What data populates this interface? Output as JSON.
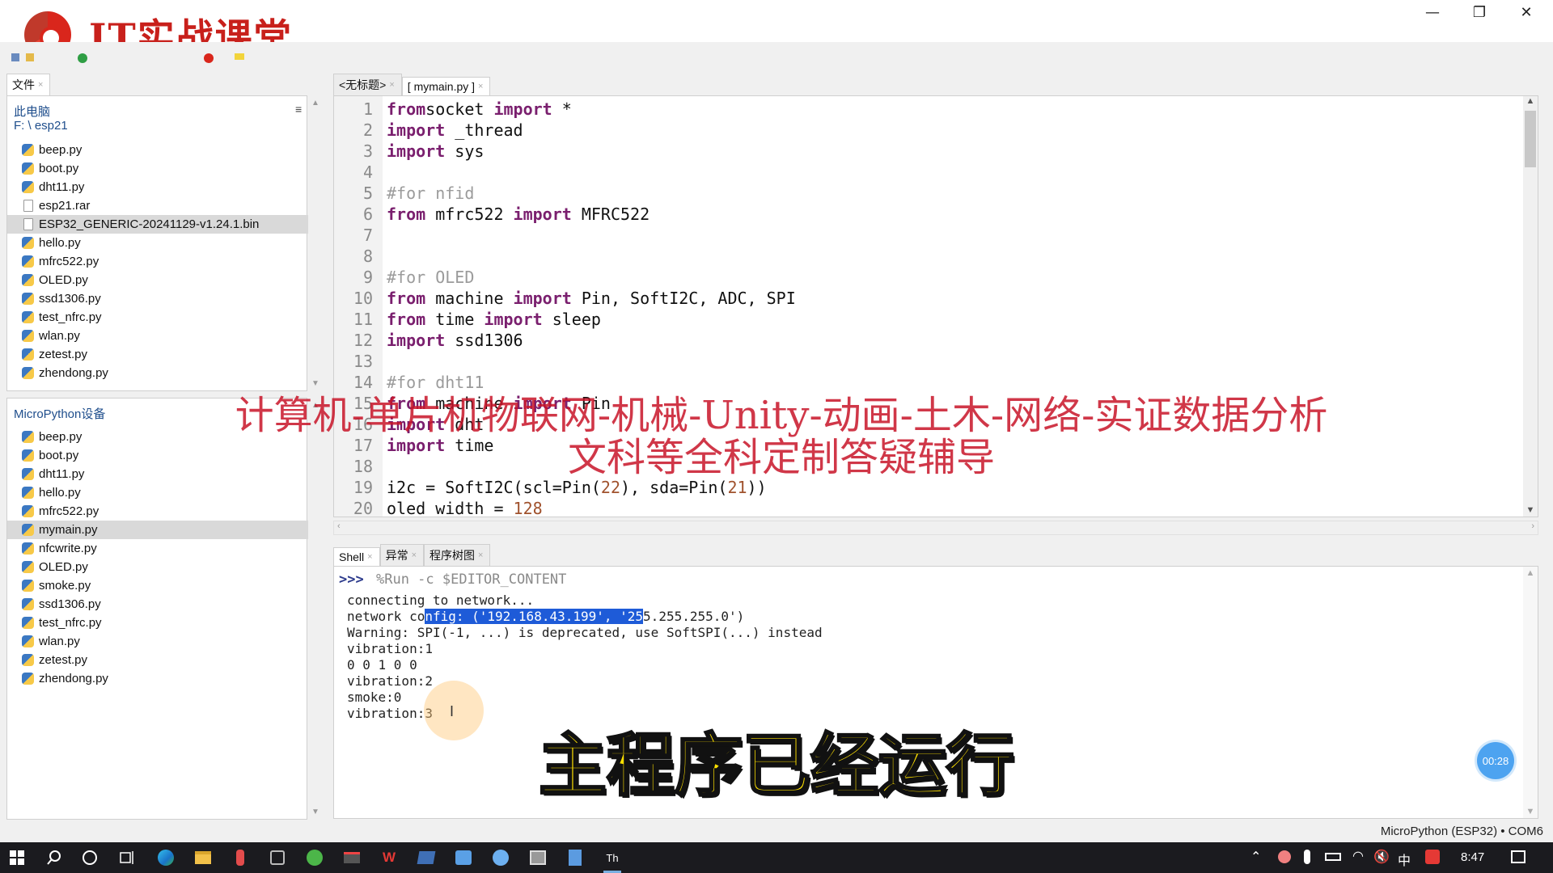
{
  "logo": {
    "text": "IT实战课堂"
  },
  "window": {
    "minimize": "—",
    "maximize": "❐",
    "close": "✕"
  },
  "files_panel": {
    "tab_label": "文件",
    "computer_label": "此电脑",
    "path": "F: \\ esp21",
    "items": [
      {
        "name": "beep.py",
        "type": "py"
      },
      {
        "name": "boot.py",
        "type": "py"
      },
      {
        "name": "dht11.py",
        "type": "py"
      },
      {
        "name": "esp21.rar",
        "type": "file"
      },
      {
        "name": "ESP32_GENERIC-20241129-v1.24.1.bin",
        "type": "file",
        "selected": true
      },
      {
        "name": "hello.py",
        "type": "py"
      },
      {
        "name": "mfrc522.py",
        "type": "py"
      },
      {
        "name": "OLED.py",
        "type": "py"
      },
      {
        "name": "ssd1306.py",
        "type": "py"
      },
      {
        "name": "test_nfrc.py",
        "type": "py"
      },
      {
        "name": "wlan.py",
        "type": "py"
      },
      {
        "name": "zetest.py",
        "type": "py"
      },
      {
        "name": "zhendong.py",
        "type": "py"
      }
    ]
  },
  "device_panel": {
    "title": "MicroPython设备",
    "items": [
      {
        "name": "beep.py"
      },
      {
        "name": "boot.py"
      },
      {
        "name": "dht11.py"
      },
      {
        "name": "hello.py"
      },
      {
        "name": "mfrc522.py"
      },
      {
        "name": "mymain.py",
        "selected": true
      },
      {
        "name": "nfcwrite.py"
      },
      {
        "name": "OLED.py"
      },
      {
        "name": "smoke.py"
      },
      {
        "name": "ssd1306.py"
      },
      {
        "name": "test_nfrc.py"
      },
      {
        "name": "wlan.py"
      },
      {
        "name": "zetest.py"
      },
      {
        "name": "zhendong.py"
      }
    ]
  },
  "editor": {
    "tabs": [
      "<无标题>",
      "[ mymain.py ]"
    ],
    "lines": [
      [
        [
          "kw",
          "from"
        ],
        [
          "",
          "socket "
        ],
        [
          "kw",
          "import"
        ],
        [
          "",
          " *"
        ]
      ],
      [
        [
          "kw",
          "import"
        ],
        [
          "",
          " _thread"
        ]
      ],
      [
        [
          "kw",
          "import"
        ],
        [
          "",
          " sys"
        ]
      ],
      [],
      [
        [
          "cm",
          "#for nfid"
        ]
      ],
      [
        [
          "kw",
          "from"
        ],
        [
          "",
          " mfrc522 "
        ],
        [
          "kw",
          "import"
        ],
        [
          "",
          " MFRC522"
        ]
      ],
      [],
      [],
      [
        [
          "cm",
          "#for OLED"
        ]
      ],
      [
        [
          "kw",
          "from"
        ],
        [
          "",
          " machine "
        ],
        [
          "kw",
          "import"
        ],
        [
          "",
          " Pin, SoftI2C, ADC, SPI"
        ]
      ],
      [
        [
          "kw",
          "from"
        ],
        [
          "",
          " time "
        ],
        [
          "kw",
          "import"
        ],
        [
          "",
          " sleep"
        ]
      ],
      [
        [
          "kw",
          "import"
        ],
        [
          "",
          " ssd1306"
        ]
      ],
      [],
      [
        [
          "cm",
          "#for dht11"
        ]
      ],
      [
        [
          "kw",
          "from"
        ],
        [
          "",
          " machine "
        ],
        [
          "kw",
          "import"
        ],
        [
          "",
          " Pin"
        ]
      ],
      [
        [
          "kw",
          "import"
        ],
        [
          "",
          " dht"
        ]
      ],
      [
        [
          "kw",
          "import"
        ],
        [
          "",
          " time"
        ]
      ],
      [],
      [
        [
          "",
          "i2c = SoftI2C(scl=Pin("
        ],
        [
          "num",
          "22"
        ],
        [
          "",
          "), sda=Pin("
        ],
        [
          "num",
          "21"
        ],
        [
          "",
          "))"
        ]
      ],
      [
        [
          "",
          "oled width = "
        ],
        [
          "num",
          "128"
        ]
      ]
    ]
  },
  "shell": {
    "tabs": [
      "Shell",
      "异常",
      "程序树图"
    ],
    "prompt": ">>>",
    "command": "%Run -c $EDITOR_CONTENT",
    "output": [
      "connecting to network...",
      "network config: ('192.168.43.199', '255.255.255.0')",
      "Warning: SPI(-1, ...) is deprecated, use SoftSPI(...) instead",
      "vibration:1",
      "0 0 1 0 0",
      "vibration:2",
      "smoke:0",
      "vibration:3"
    ],
    "highlight": "nfig: ('192.168.43.199', '25"
  },
  "overlay": {
    "line1": "计算机-单片机物联网-机械-Unity-动画-土木-网络-实证数据分析",
    "line2": "文科等全科定制答疑辅导",
    "subtitle": "主程序已经运行",
    "timer": "00:28"
  },
  "status": {
    "interpreter": "MicroPython (ESP32)  •  COM6"
  },
  "taskbar": {
    "ime": "中",
    "clock": "8:47"
  }
}
